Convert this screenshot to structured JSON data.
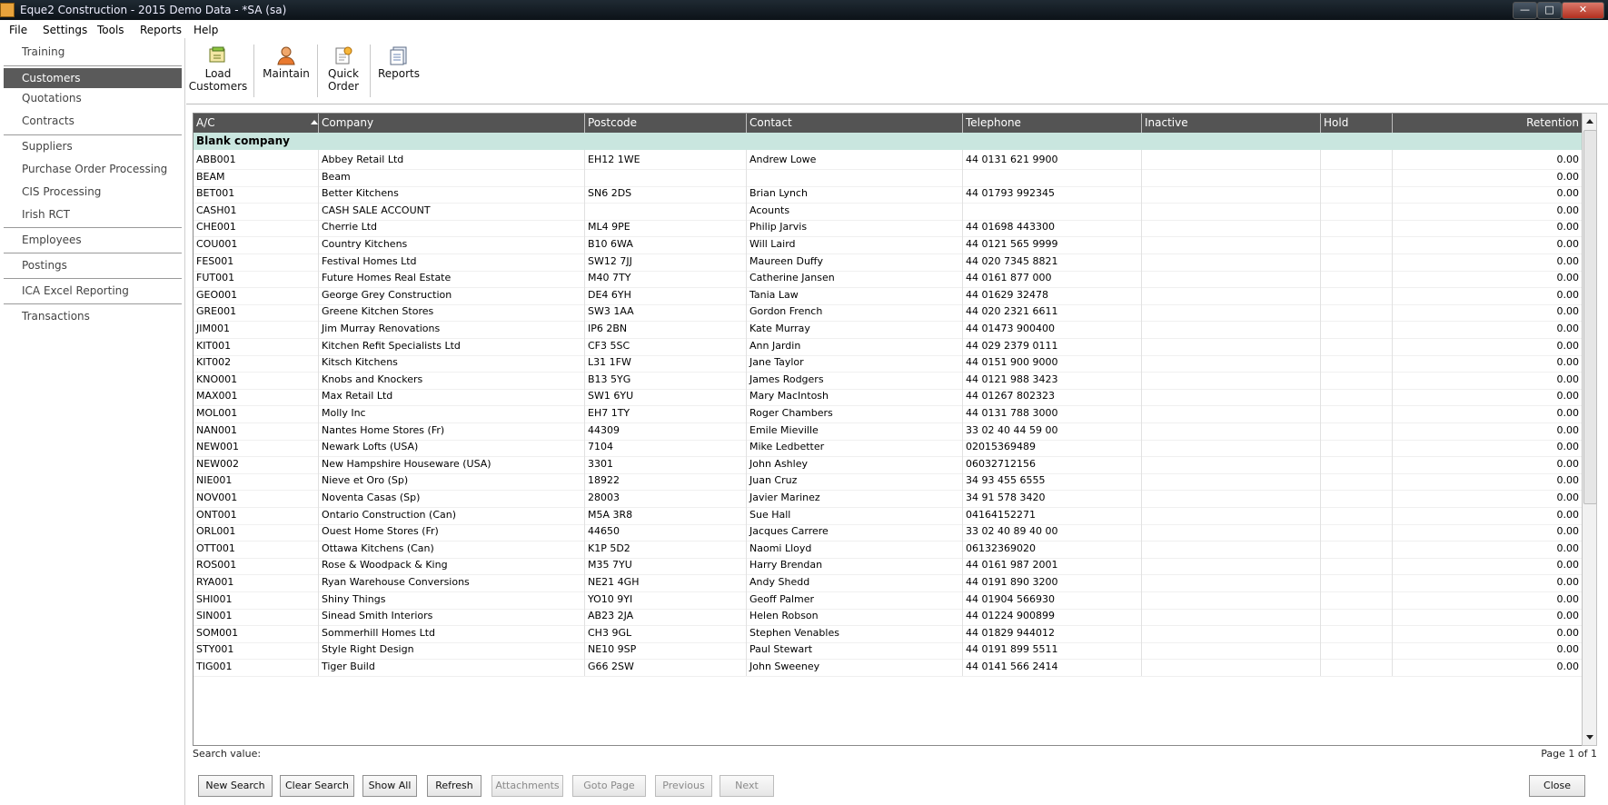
{
  "window": {
    "title": "Eque2 Construction - 2015 Demo Data - *SA (sa)"
  },
  "menu": [
    {
      "label": "File"
    },
    {
      "label": "Settings"
    },
    {
      "label": "Tools"
    },
    {
      "label": "Reports"
    },
    {
      "label": "Help"
    }
  ],
  "sidebar": {
    "items": [
      {
        "label": "Training"
      },
      {
        "label": "Customers",
        "active": true
      },
      {
        "label": "Quotations"
      },
      {
        "label": "Contracts"
      },
      {
        "label": "Suppliers"
      },
      {
        "label": "Purchase Order Processing"
      },
      {
        "label": "CIS Processing"
      },
      {
        "label": "Irish RCT"
      },
      {
        "label": "Employees"
      },
      {
        "label": "Postings"
      },
      {
        "label": "ICA Excel Reporting"
      },
      {
        "label": "Transactions"
      }
    ]
  },
  "toolbar": {
    "load_line1": "Load",
    "load_line2": "Customers",
    "maintain": "Maintain",
    "quick_line1": "Quick",
    "quick_line2": "Order",
    "reports": "Reports"
  },
  "grid": {
    "columns": [
      "A/C",
      "Company",
      "Postcode",
      "Contact",
      "Telephone",
      "Inactive",
      "Hold",
      "Retention"
    ],
    "group": "Blank company",
    "rows": [
      [
        "ABB001",
        "Abbey Retail Ltd",
        "EH12 1WE",
        "Andrew Lowe",
        "44 0131 621 9900",
        "",
        "",
        "0.00"
      ],
      [
        "BEAM",
        "Beam",
        "",
        "",
        "",
        "",
        "",
        "0.00"
      ],
      [
        "BET001",
        "Better Kitchens",
        "SN6 2DS",
        "Brian Lynch",
        "44 01793 992345",
        "",
        "",
        "0.00"
      ],
      [
        "CASH01",
        "CASH SALE ACCOUNT",
        "",
        "Acounts",
        "",
        "",
        "",
        "0.00"
      ],
      [
        "CHE001",
        "Cherrie Ltd",
        "ML4 9PE",
        "Philip Jarvis",
        "44 01698 443300",
        "",
        "",
        "0.00"
      ],
      [
        "COU001",
        "Country Kitchens",
        "B10 6WA",
        "Will Laird",
        "44 0121 565 9999",
        "",
        "",
        "0.00"
      ],
      [
        "FES001",
        "Festival Homes Ltd",
        "SW12 7JJ",
        "Maureen Duffy",
        "44 020 7345 8821",
        "",
        "",
        "0.00"
      ],
      [
        "FUT001",
        "Future Homes Real Estate",
        "M40 7TY",
        "Catherine Jansen",
        "44 0161 877 000",
        "",
        "",
        "0.00"
      ],
      [
        "GEO001",
        "George Grey Construction",
        "DE4 6YH",
        "Tania Law",
        "44 01629 32478",
        "",
        "",
        "0.00"
      ],
      [
        "GRE001",
        "Greene Kitchen Stores",
        "SW3 1AA",
        "Gordon French",
        "44 020 2321 6611",
        "",
        "",
        "0.00"
      ],
      [
        "JIM001",
        "Jim Murray Renovations",
        "IP6 2BN",
        "Kate Murray",
        "44 01473 900400",
        "",
        "",
        "0.00"
      ],
      [
        "KIT001",
        "Kitchen Refit Specialists Ltd",
        "CF3 5SC",
        "Ann Jardin",
        "44 029 2379 0111",
        "",
        "",
        "0.00"
      ],
      [
        "KIT002",
        "Kitsch Kitchens",
        "L31 1FW",
        "Jane Taylor",
        "44 0151 900 9000",
        "",
        "",
        "0.00"
      ],
      [
        "KNO001",
        "Knobs and Knockers",
        "B13 5YG",
        "James Rodgers",
        "44 0121 988 3423",
        "",
        "",
        "0.00"
      ],
      [
        "MAX001",
        "Max Retail Ltd",
        "SW1 6YU",
        "Mary MacIntosh",
        "44 01267 802323",
        "",
        "",
        "0.00"
      ],
      [
        "MOL001",
        "Molly Inc",
        "EH7 1TY",
        "Roger Chambers",
        "44 0131 788 3000",
        "",
        "",
        "0.00"
      ],
      [
        "NAN001",
        "Nantes Home Stores (Fr)",
        "44309",
        "Emile Mieville",
        "33 02 40 44 59 00",
        "",
        "",
        "0.00"
      ],
      [
        "NEW001",
        "Newark Lofts (USA)",
        "7104",
        "Mike Ledbetter",
        "02015369489",
        "",
        "",
        "0.00"
      ],
      [
        "NEW002",
        "New Hampshire Houseware (USA)",
        "3301",
        "John Ashley",
        "06032712156",
        "",
        "",
        "0.00"
      ],
      [
        "NIE001",
        "Nieve et Oro (Sp)",
        "18922",
        "Juan Cruz",
        "34 93 455 6555",
        "",
        "",
        "0.00"
      ],
      [
        "NOV001",
        "Noventa Casas (Sp)",
        "28003",
        "Javier Marinez",
        "34 91 578 3420",
        "",
        "",
        "0.00"
      ],
      [
        "ONT001",
        "Ontario Construction (Can)",
        "M5A 3R8",
        "Sue Hall",
        "04164152271",
        "",
        "",
        "0.00"
      ],
      [
        "ORL001",
        "Ouest Home Stores (Fr)",
        "44650",
        "Jacques Carrere",
        "33 02 40 89 40 00",
        "",
        "",
        "0.00"
      ],
      [
        "OTT001",
        "Ottawa Kitchens (Can)",
        "K1P 5D2",
        "Naomi Lloyd",
        "06132369020",
        "",
        "",
        "0.00"
      ],
      [
        "ROS001",
        "Rose & Woodpack & King",
        "M35 7YU",
        "Harry Brendan",
        "44 0161 987 2001",
        "",
        "",
        "0.00"
      ],
      [
        "RYA001",
        "Ryan Warehouse Conversions",
        "NE21 4GH",
        "Andy Shedd",
        "44 0191 890 3200",
        "",
        "",
        "0.00"
      ],
      [
        "SHI001",
        "Shiny Things",
        "YO10 9YI",
        "Geoff Palmer",
        "44 01904 566930",
        "",
        "",
        "0.00"
      ],
      [
        "SIN001",
        "Sinead Smith Interiors",
        "AB23 2JA",
        "Helen Robson",
        "44 01224 900899",
        "",
        "",
        "0.00"
      ],
      [
        "SOM001",
        "Sommerhill Homes Ltd",
        "CH3 9GL",
        "Stephen Venables",
        "44 01829 944012",
        "",
        "",
        "0.00"
      ],
      [
        "STY001",
        "Style Right Design",
        "NE10 9SP",
        "Paul Stewart",
        "44 0191 899 5511",
        "",
        "",
        "0.00"
      ],
      [
        "TIG001",
        "Tiger Build",
        "G66 2SW",
        "John Sweeney",
        "44 0141 566 2414",
        "",
        "",
        "0.00"
      ]
    ]
  },
  "footer": {
    "search_label": "Search value:",
    "page_info": "Page 1 of 1",
    "buttons": {
      "new_search": "New Search",
      "clear_search": "Clear Search",
      "show_all": "Show All",
      "refresh": "Refresh",
      "attachments": "Attachments",
      "goto_page": "Goto Page",
      "previous": "Previous",
      "next": "Next",
      "close": "Close"
    }
  }
}
